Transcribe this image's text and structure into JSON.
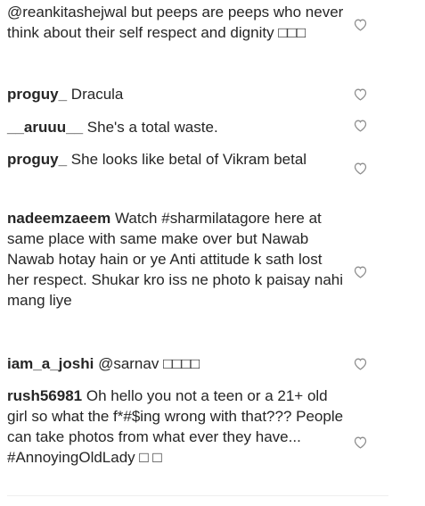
{
  "comments": [
    {
      "username": "",
      "text": "@reankitashejwal but peeps are peeps who never think about their self respect and dignity □□□",
      "mention": "@reankitashejwal",
      "rest": " but peeps are peeps who never think about their self respect and dignity □□□",
      "icon": "heart-outline-icon"
    },
    {
      "username": "proguy_",
      "text": "Dracula",
      "icon": "heart-outline-icon"
    },
    {
      "username": "__aruuu__",
      "text": "She's a total waste.",
      "icon": "heart-outline-icon"
    },
    {
      "username": "proguy_",
      "text": "She looks like betal of Vikram betal",
      "icon": "heart-outline-icon"
    },
    {
      "username": "nadeemzaeem",
      "text": "Watch #sharmilatagore here at same place with same make over but Nawab Nawab hotay hain or ye Anti attitude k sath lost her respect. Shukar kro iss ne photo k paisay nahi mang liye",
      "icon": "heart-outline-icon"
    },
    {
      "username": "iam_a_joshi",
      "text": "@sarnav □□□□",
      "icon": "heart-outline-icon"
    },
    {
      "username": "rush56981",
      "text": "Oh hello you not a teen or a 21+ old girl so what the f*#$ing wrong with that??? People can take photos from what ever they have... #AnnoyingOldLady □ □",
      "icon": "heart-outline-icon"
    }
  ]
}
